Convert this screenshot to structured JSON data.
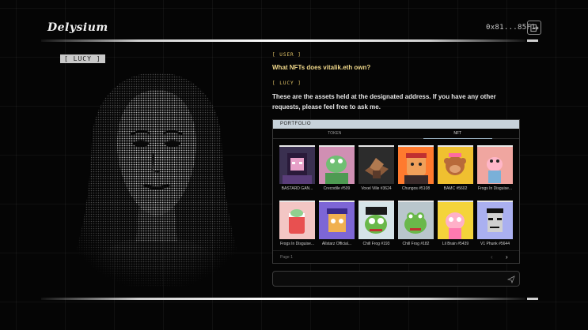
{
  "header": {
    "logo": "Delysium",
    "wallet_address": "0x81...85F1"
  },
  "character": {
    "tag": "[ LUCY ]"
  },
  "chat": {
    "messages": [
      {
        "role": "[ USER ]",
        "text": "What NFTs does vitalik.eth own?"
      },
      {
        "role": "[ LUCY ]",
        "text": "These are the assets held at the designated address. If you have any other requests, please feel free to ask me."
      }
    ]
  },
  "portfolio": {
    "title": "PORTFOLIO",
    "tabs": [
      {
        "label": "TOKEN",
        "active": false
      },
      {
        "label": "NFT",
        "active": true
      }
    ],
    "nfts": [
      {
        "name": "BASTARD GAN...",
        "bg": "#3a3050",
        "art": "punkhood"
      },
      {
        "name": "Crecodile #509",
        "bg": "#d08fb3",
        "art": "croc"
      },
      {
        "name": "Voxel Ville #3624",
        "bg": "#2c2c2c",
        "art": "voxel"
      },
      {
        "name": "Chungos #5108",
        "bg": "#ff7a2e",
        "art": "chungo"
      },
      {
        "name": "BAMC #5602",
        "bg": "#f0c030",
        "art": "monkey"
      },
      {
        "name": "Frogs In Disguise...",
        "bg": "#f0a6a0",
        "art": "frogpink"
      },
      {
        "name": "Frogs In Disguise...",
        "bg": "#f3c6c4",
        "art": "frogcup"
      },
      {
        "name": "Allstarz Official...",
        "bg": "#7d66d6",
        "art": "allstarz"
      },
      {
        "name": "Chill Frog #193",
        "bg": "#d6e4e8",
        "art": "pirate"
      },
      {
        "name": "Chill Frog #182",
        "bg": "#b9c6cc",
        "art": "chillfrog"
      },
      {
        "name": "Lil Brain #5439",
        "bg": "#f4d43a",
        "art": "brain"
      },
      {
        "name": "V1 Phunk #5644",
        "bg": "#aab0f0",
        "art": "phunk"
      }
    ],
    "page_label": "Page 1",
    "prev_icon": "chevron-left-icon",
    "next_icon": "chevron-right-icon"
  },
  "input": {
    "placeholder": "",
    "send_icon": "send-icon"
  },
  "colors": {
    "accent_user": "#f0d88a",
    "header_bar": "#c7d2da"
  }
}
